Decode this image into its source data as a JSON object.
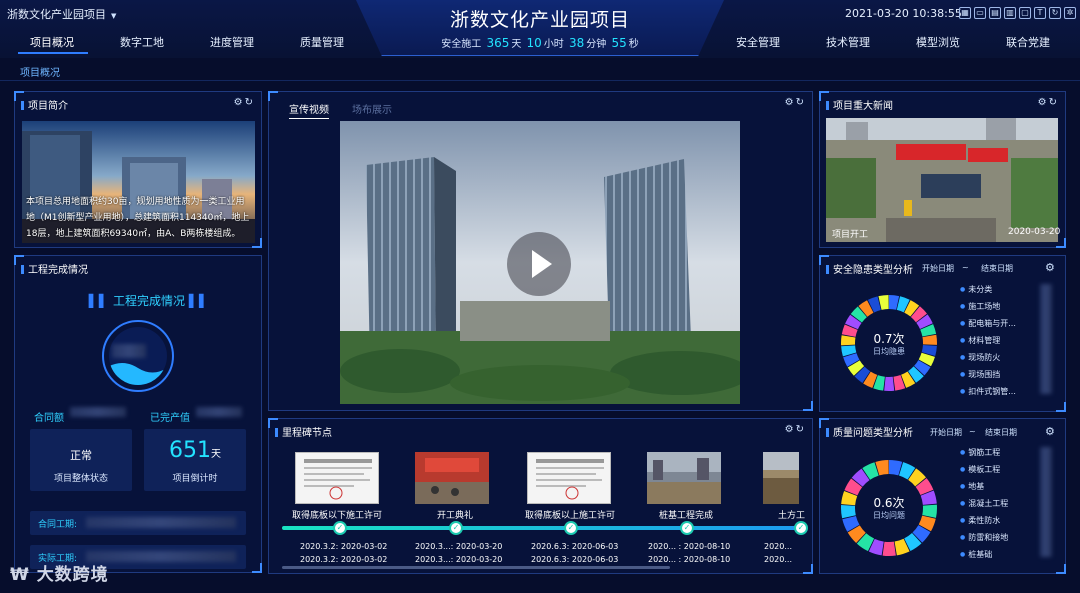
{
  "header": {
    "project_selector": "浙数文化产业园项目",
    "main_title": "浙数文化产业园项目",
    "safety_prefix": "安全施工",
    "safety_days": "365",
    "safety_days_unit": "天",
    "safety_hours": "10",
    "safety_hours_unit": "小时",
    "safety_minutes": "38",
    "safety_minutes_unit": "分钟",
    "safety_seconds": "55",
    "safety_seconds_unit": "秒",
    "datetime": "2021-03-20 10:38:55",
    "nav_left": [
      "项目概况",
      "数字工地",
      "进度管理",
      "质量管理"
    ],
    "nav_right": [
      "安全管理",
      "技术管理",
      "模型浏览",
      "联合党建"
    ]
  },
  "subnav": {
    "active": "项目概况"
  },
  "intro": {
    "title": "项目简介",
    "text": "本项目总用地面积约30亩，规划用地性质为一类工业用地（M1创新型产业用地），总建筑面积114340㎡，地上18层，地上建筑面积69340㎡，由A、B两栋楼组成。"
  },
  "completion": {
    "title": "工程完成情况",
    "heading": "工程完成情况",
    "contract_label": "合同额",
    "output_label": "已完产值",
    "status_value": "正常",
    "status_label": "项目整体状态",
    "countdown_value": "651",
    "countdown_unit": "天",
    "countdown_label": "项目倒计时",
    "contract_period_label": "合同工期:",
    "actual_period_label": "实际工期:"
  },
  "video": {
    "tab_active": "宣传视频",
    "tab_inactive": "场布展示"
  },
  "milestones": {
    "title": "里程碑节点",
    "items": [
      {
        "label": "取得底板以下施工许可",
        "date1": "2020.3.2: 2020-03-02",
        "date2": "2020.3.2: 2020-03-02"
      },
      {
        "label": "开工典礼",
        "date1": "2020.3...: 2020-03-20",
        "date2": "2020.3...: 2020-03-20"
      },
      {
        "label": "取得底板以上施工许可",
        "date1": "2020.6.3: 2020-06-03",
        "date2": "2020.6.3: 2020-06-03"
      },
      {
        "label": "桩基工程完成",
        "date1": "2020... : 2020-08-10",
        "date2": "2020... : 2020-08-10"
      },
      {
        "label": "土方工",
        "date1": "2020...",
        "date2": "2020..."
      }
    ]
  },
  "news": {
    "title": "项目重大新闻",
    "caption": "项目开工",
    "date": "2020-03-20"
  },
  "safety_hazard": {
    "title": "安全隐患类型分析",
    "start_label": "开始日期",
    "sep": "~",
    "end_label": "结束日期",
    "center_value": "0.7次",
    "center_label": "日均隐患",
    "legend": [
      "未分类",
      "施工场地",
      "配电箱与开...",
      "材料管理",
      "现场防火",
      "现场围挡",
      "扣件式钢管..."
    ],
    "colors": [
      "#2f6bff",
      "#1fc6ff",
      "#ffd21f",
      "#ff4d8d",
      "#a04dff",
      "#25e3a5",
      "#ff8a1f",
      "#1a4dd6",
      "#e8ff3a"
    ]
  },
  "quality": {
    "title": "质量问题类型分析",
    "start_label": "开始日期",
    "sep": "~",
    "end_label": "结束日期",
    "center_value": "0.6次",
    "center_label": "日均问题",
    "legend": [
      "钢筋工程",
      "模板工程",
      "地基",
      "混凝土工程",
      "柔性防水",
      "防雷和接地",
      "桩基础"
    ],
    "colors": [
      "#2f6bff",
      "#1fc6ff",
      "#ffd21f",
      "#ff4d8d",
      "#a04dff",
      "#25e3a5",
      "#ff8a1f"
    ]
  },
  "watermark": "大数跨境"
}
